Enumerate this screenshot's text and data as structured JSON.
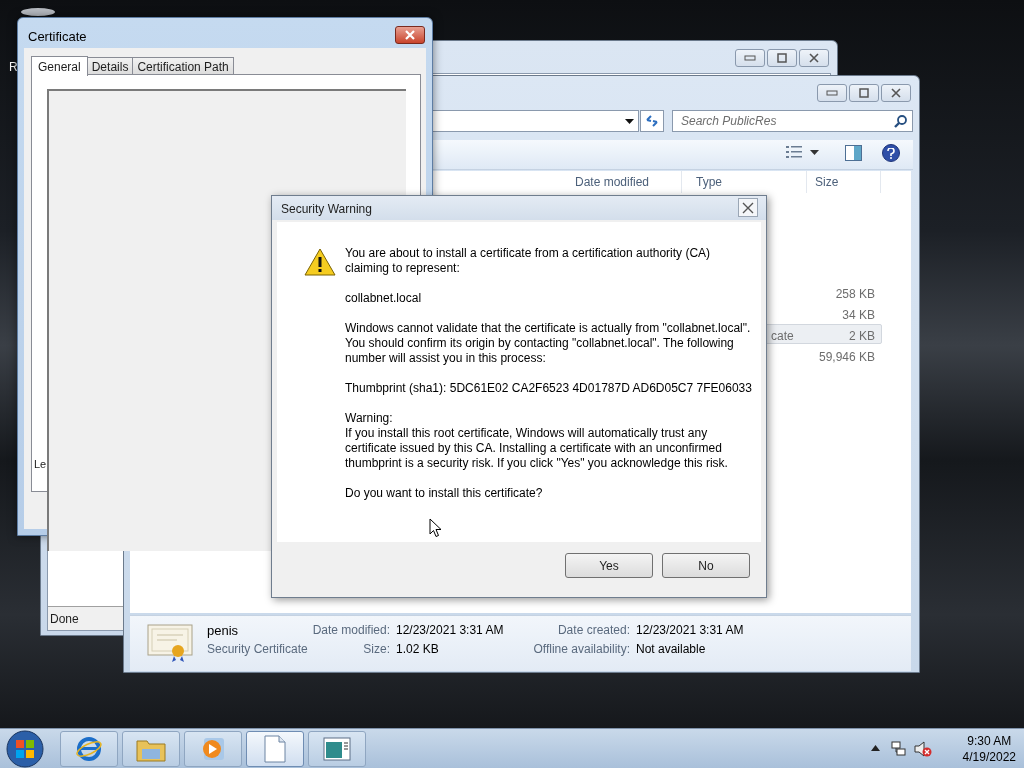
{
  "desktop": {
    "icon_label": "R"
  },
  "browser_window": {
    "status": "Done"
  },
  "explorer": {
    "search_placeholder": "Search PublicRes",
    "columns": [
      "Date modified",
      "Type",
      "Size"
    ],
    "rows": [
      {
        "size": "258 KB",
        "selected": false
      },
      {
        "size": "34 KB",
        "selected": false
      },
      {
        "type": "cate",
        "size": "2 KB",
        "selected": true
      },
      {
        "size": "59,946 KB",
        "selected": false
      }
    ],
    "details": {
      "name": "penis",
      "type": "Security Certificate",
      "fields": [
        {
          "label": "Date modified:",
          "value": "12/23/2021 3:31 AM"
        },
        {
          "label": "Date created:",
          "value": "12/23/2021 3:31 AM"
        },
        {
          "label": "Size:",
          "value": "1.02 KB"
        },
        {
          "label": "Offline availability:",
          "value": "Not available"
        }
      ]
    }
  },
  "certificate_dialog": {
    "title": "Certificate",
    "tabs": [
      {
        "label": "General",
        "selected": true
      },
      {
        "label": "Details",
        "selected": false
      },
      {
        "label": "Certification Path",
        "selected": false
      }
    ],
    "partial_text": "Le"
  },
  "security_warning": {
    "title": "Security Warning",
    "blocks": [
      {
        "lines": [
          "You are about to install a certificate from a certification authority (CA) claiming to represent:"
        ]
      },
      {
        "lines": [
          "collabnet.local"
        ]
      },
      {
        "lines": [
          "Windows cannot validate that the certificate is actually from \"collabnet.local\". You should confirm its origin by contacting \"collabnet.local\". The following number will assist you in this process:"
        ]
      },
      {
        "lines": [
          "Thumbprint (sha1): 5DC61E02 CA2F6523 4D01787D AD6D05C7 7FE06033"
        ]
      },
      {
        "lines": [
          "Warning:",
          "If you install this root certificate, Windows will automatically trust any certificate issued by this CA. Installing a certificate with an unconfirmed thumbprint is a security risk. If you click \"Yes\" you acknowledge this risk."
        ]
      },
      {
        "lines": [
          "Do you want to install this certificate?"
        ]
      }
    ],
    "buttons": [
      "Yes",
      "No"
    ]
  },
  "taskbar": {
    "items": [
      {
        "kind": "browser",
        "selected": false
      },
      {
        "kind": "folder",
        "selected": false
      },
      {
        "kind": "media",
        "selected": false
      },
      {
        "kind": "document",
        "selected": true
      },
      {
        "kind": "window",
        "selected": false
      }
    ],
    "clock": {
      "time": "9:30 AM",
      "date": "4/19/2022"
    }
  }
}
